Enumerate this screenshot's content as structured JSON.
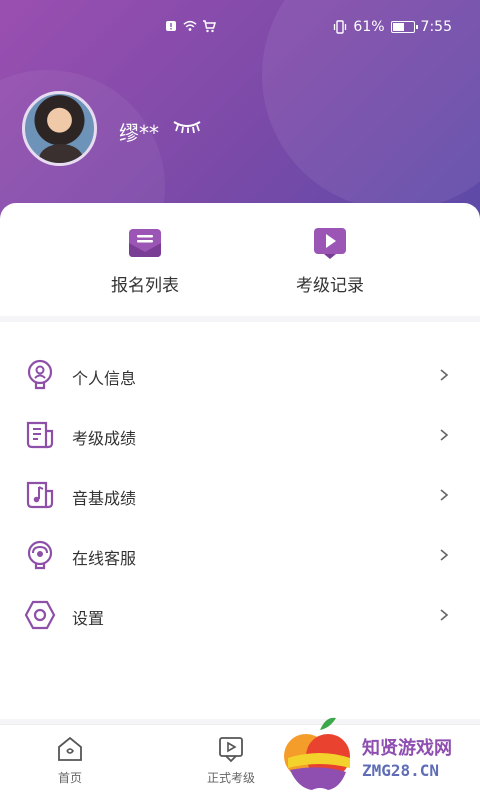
{
  "status_bar": {
    "battery_percent": "61%",
    "battery_level": 0.61,
    "time": "7:55"
  },
  "profile": {
    "username": "缪**"
  },
  "quick_actions": [
    {
      "label": "报名列表",
      "icon": "envelope-icon"
    },
    {
      "label": "考级记录",
      "icon": "video-play-icon"
    }
  ],
  "menu": [
    {
      "label": "个人信息",
      "icon": "person-bulb-icon"
    },
    {
      "label": "考级成绩",
      "icon": "document-list-icon"
    },
    {
      "label": "音基成绩",
      "icon": "music-note-icon"
    },
    {
      "label": "在线客服",
      "icon": "headset-icon"
    },
    {
      "label": "设置",
      "icon": "settings-hexagon-icon"
    }
  ],
  "tabbar": [
    {
      "label": "首页",
      "icon": "home-icon"
    },
    {
      "label": "正式考级",
      "icon": "exam-play-icon"
    }
  ],
  "watermark": {
    "line1": "知贤游戏网",
    "line2": "ZMG28.CN"
  },
  "colors": {
    "accent": "#8e4fa8",
    "header_gradient_start": "#9a4fb0",
    "header_gradient_end": "#5b4aa8"
  }
}
